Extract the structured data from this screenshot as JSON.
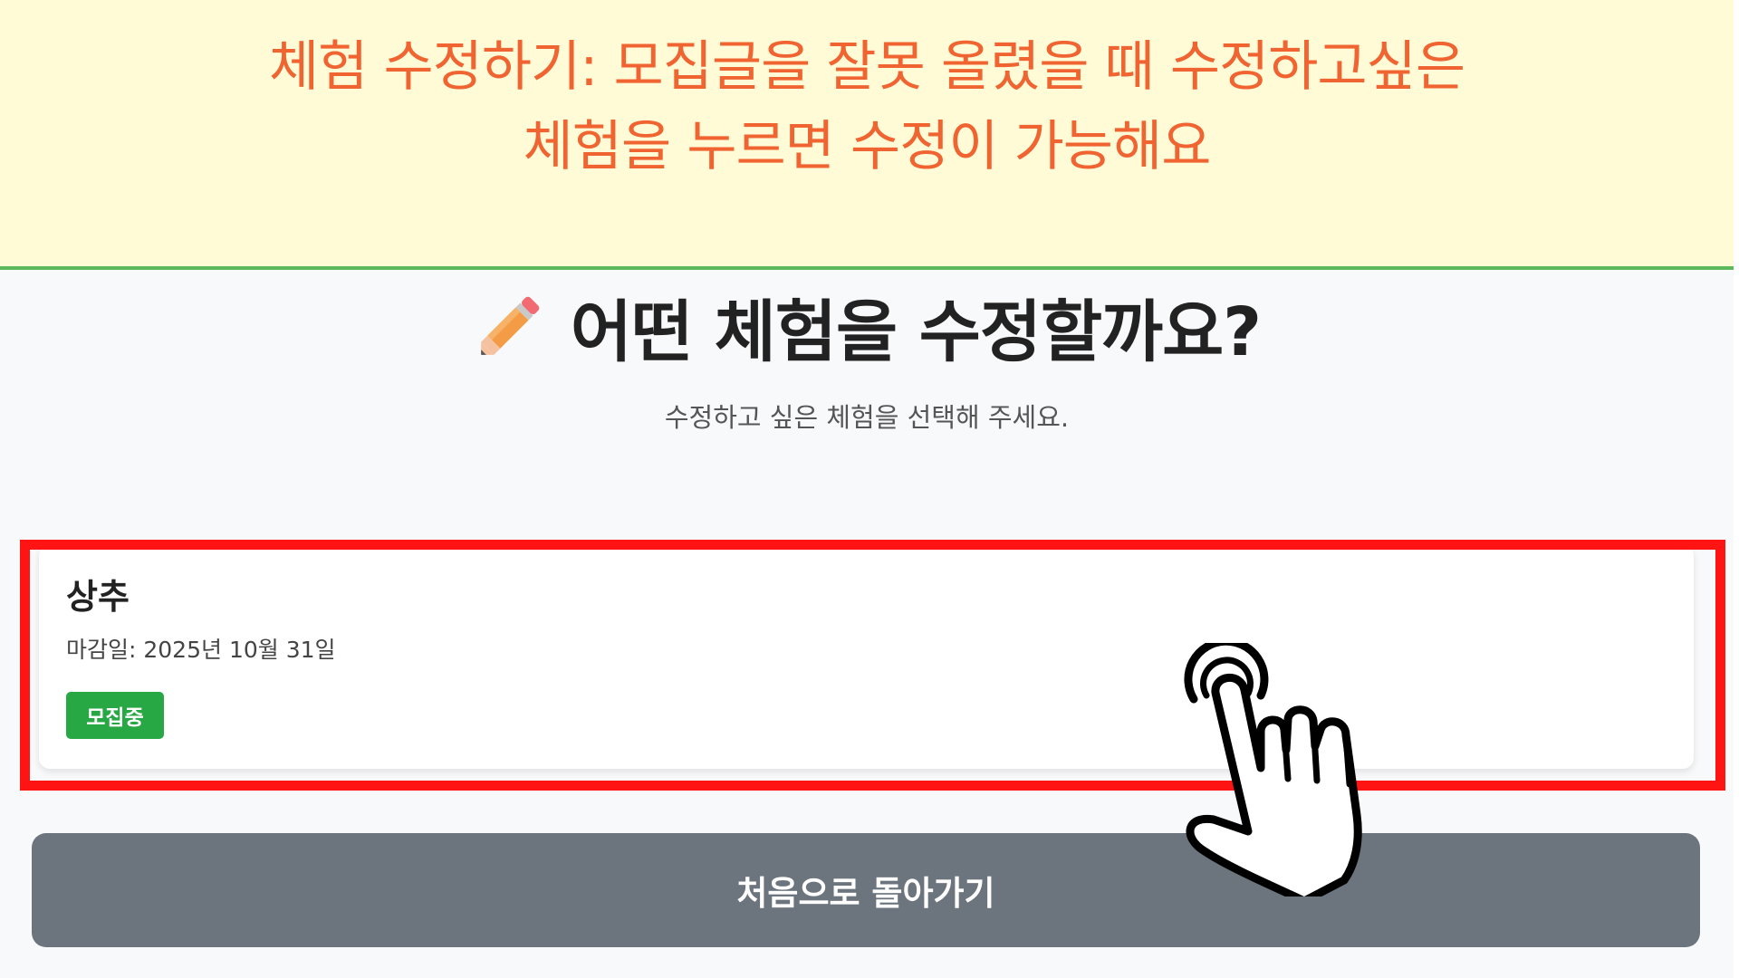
{
  "banner": {
    "line1": "체험 수정하기: 모집글을 잘못 올렸을 때 수정하고싶은",
    "line2": "체험을 누르면 수정이 가능해요"
  },
  "header": {
    "icon": "pencil-icon",
    "title": "어떤 체험을 수정할까요?",
    "subtitle": "수정하고 싶은 체험을 선택해 주세요."
  },
  "experiences": [
    {
      "title": "상추",
      "deadline": "마감일: 2025년 10월 31일",
      "status": "모집중"
    }
  ],
  "back_button": {
    "label": "처음으로 돌아가기"
  },
  "annotations": {
    "pointer_icon": "pointing-hand-icon",
    "highlight_color": "#ff1414"
  },
  "colors": {
    "banner_background": "#fffbd6",
    "banner_text": "#f06432",
    "banner_border": "#5cb85c",
    "status_badge": "#28a745",
    "back_button": "#6c757d"
  }
}
